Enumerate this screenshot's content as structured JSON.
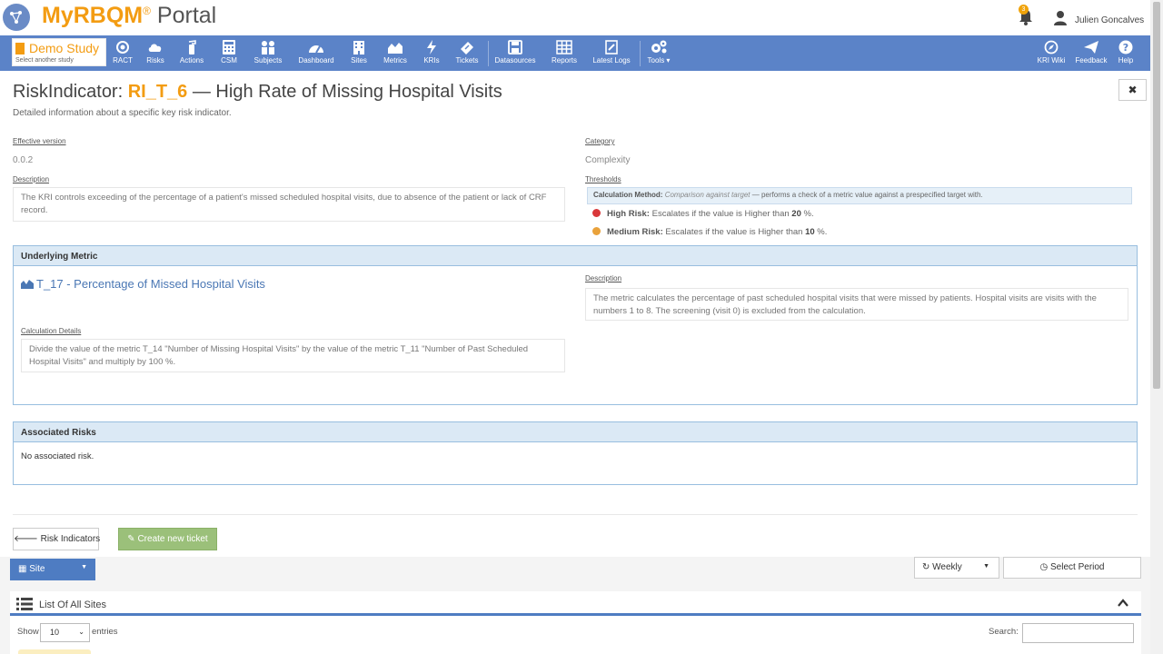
{
  "brand": {
    "name_prefix": "My",
    "name_bold": "RBQM",
    "reg": "®",
    "name_suffix": "Portal"
  },
  "user": {
    "name": "Julien Goncalves",
    "notifications": "3"
  },
  "study": {
    "name": "Demo Study",
    "sub": "Select another study"
  },
  "nav": {
    "items": [
      "RACT",
      "Risks",
      "Actions",
      "CSM",
      "Subjects",
      "Dashboard",
      "Sites",
      "Metrics",
      "KRIs",
      "Tickets",
      "Datasources",
      "Reports",
      "Latest Logs",
      "Tools ▾"
    ],
    "right": [
      "KRI Wiki",
      "Feedback",
      "Help"
    ]
  },
  "page": {
    "prefix": "RiskIndicator:",
    "code": "RI_T_6",
    "title": "— High Rate of Missing Hospital Visits",
    "subtitle": "Detailed information about a specific key risk indicator."
  },
  "details": {
    "effective_version_label": "Effective version",
    "effective_version": "0.0.2",
    "category_label": "Category",
    "category": "Complexity",
    "description_label": "Description",
    "description": "The KRI controls exceeding of the percentage of a patient's missed scheduled hospital visits, due to absence of the patient or lack of CRF record.",
    "thresholds_label": "Thresholds",
    "calc_method_label": "Calculation Method:",
    "calc_method_name": "Comparison against target",
    "calc_method_desc": "— performs a check of a metric value against a prespecified target with.",
    "high_label": "High Risk:",
    "high_text": "Escalates if the value is Higher than",
    "high_value": "20",
    "medium_label": "Medium Risk:",
    "medium_text": "Escalates if the value is Higher than",
    "medium_value": "10",
    "unit": "%.",
    "colors": {
      "high": "#d9383a",
      "medium": "#e9a23b"
    }
  },
  "metric_panel": {
    "title": "Underlying Metric",
    "metric_name": "T_17 - Percentage of Missed Hospital Visits",
    "description_label": "Description",
    "description": "The metric calculates the percentage of past scheduled hospital visits that were missed by patients. Hospital visits are visits with the numbers 1 to 8. The screening (visit 0) is excluded from the calculation.",
    "calc_details_label": "Calculation Details",
    "calc_details": "Divide the value of the metric T_14 \"Number of Missing Hospital Visits\" by the value of the metric T_11 \"Number of Past Scheduled Hospital Visits\" and multiply by 100 %."
  },
  "risks_panel": {
    "title": "Associated Risks",
    "text": "No associated risk."
  },
  "buttons": {
    "back": "Risk Indicators",
    "create": "Create new ticket"
  },
  "bottom": {
    "site": "Site",
    "weekly": "Weekly",
    "select_period": "Select Period",
    "list_title": "List Of All Sites",
    "show": "Show",
    "entries_value": "10",
    "entries": "entries",
    "search": "Search:"
  }
}
